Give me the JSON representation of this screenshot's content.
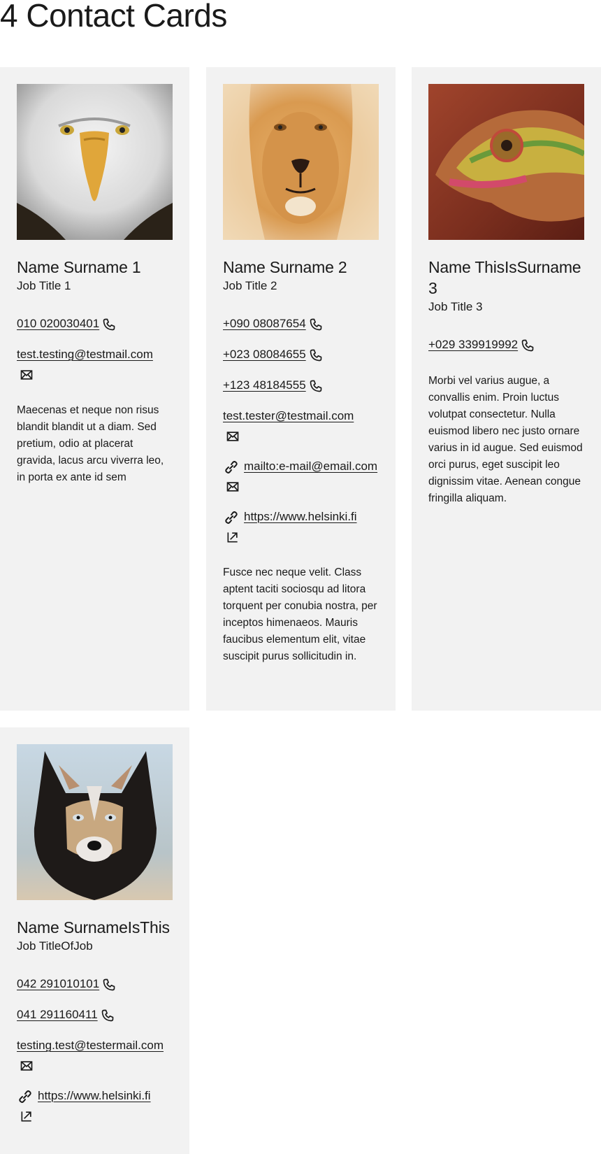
{
  "page": {
    "title": "4 Contact Cards"
  },
  "cards": [
    {
      "name": "Name Surname 1",
      "job_title": "Job Title 1",
      "photo": "eagle-photo",
      "phones": [
        "010 020030401"
      ],
      "emails": [
        "test.testing@testmail.com"
      ],
      "links": [],
      "description": "Maecenas et neque non risus blandit blandit ut a diam. Sed pretium, odio at placerat gravida, lacus arcu viverra leo, in porta ex ante id sem"
    },
    {
      "name": "Name Surname 2",
      "job_title": "Job Title 2",
      "photo": "lion-photo",
      "phones": [
        "+090 08087654",
        "+023 08084655",
        "+123 48184555"
      ],
      "emails": [
        "test.tester@testmail.com"
      ],
      "links": [
        "mailto:e-mail@email.com",
        "https://www.helsinki.fi"
      ],
      "description": "Fusce nec neque velit. Class aptent taciti sociosqu ad litora torquent per conubia nostra, per inceptos himenaeos. Mauris faucibus elementum elit, vitae suscipit purus sollicitudin in."
    },
    {
      "name": "Name ThisIsSurname 3",
      "job_title": "Job Title 3",
      "photo": "chameleon-photo",
      "phones": [
        "+029 339919992"
      ],
      "emails": [],
      "links": [],
      "description": "Morbi vel varius augue, a convallis enim. Proin luctus volutpat consectetur. Nulla euismod libero nec justo ornare varius in id augue. Sed euismod orci purus, eget suscipit leo dignissim vitae. Aenean congue fringilla aliquam."
    },
    {
      "name": "Name SurnameIsThis",
      "job_title": "Job TitleOfJob",
      "photo": "husky-photo",
      "phones": [
        "042 291010101",
        "041 291160411"
      ],
      "emails": [
        "testing.test@testermail.com"
      ],
      "links": [
        "https://www.helsinki.fi"
      ],
      "description": ""
    }
  ],
  "icons": {
    "phone": "phone-icon",
    "email": "envelope-icon",
    "link": "link-icon",
    "external": "external-link-icon"
  }
}
